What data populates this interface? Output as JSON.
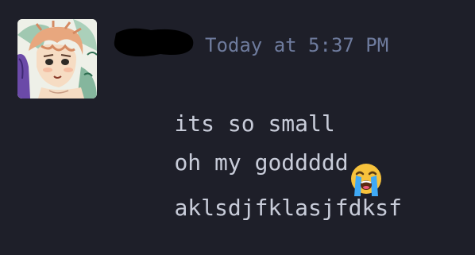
{
  "message": {
    "author": {
      "avatar_icon": "user-avatar-anime-icon",
      "name_redacted": true,
      "redaction_color": "#000000"
    },
    "timestamp": "Today at 5:37 PM",
    "lines": [
      {
        "text": "its so small",
        "emoji": "loudly-crying-face-icon"
      },
      {
        "text": "oh my goddddd"
      },
      {
        "text": "aklsdjfklasjfdksf"
      }
    ]
  },
  "colors": {
    "background": "#1e1f29",
    "timestamp": "#6e7b9d",
    "message_text": "#c8ccd9",
    "emoji_face": "#f7c23c",
    "emoji_tears": "#3fa9f5"
  }
}
